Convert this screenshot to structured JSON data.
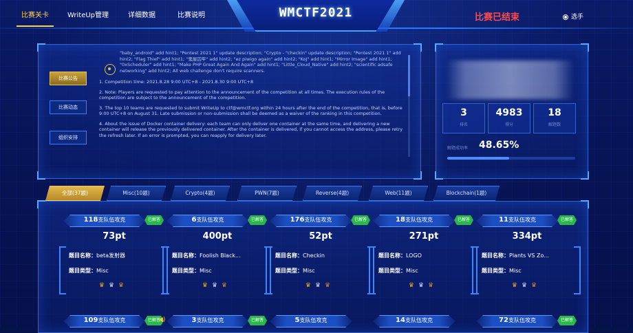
{
  "nav": {
    "items": [
      "比赛关卡",
      "WriteUp管理",
      "详细数据",
      "比赛说明"
    ],
    "active": "比赛关卡"
  },
  "header": {
    "title": "WMCTF2021",
    "status": "比赛已结束",
    "player_label": "选手"
  },
  "side": {
    "buttons": [
      "比赛公告",
      "比赛动态",
      "组织安排"
    ]
  },
  "notice": {
    "hints": "\"baby_android\" add hint1; \"Pentest 2021 1\" update description; \"Crypto - \"checkin\" update description; \"Pentest 2021 1\" add hint2; \"Flag Thief\" add hint1; \"鬼屋囚牢\" add hint2; \"ez piwigo again\" add hint2; \"KoJ\" add hint1; \"Mirror Image\" add hint1; \"0xScheduler\" add hint1; \"Make PHP Great Again And Again\" add hint1; \"Little_Cloud_Native\" add hint2; \"scientific adsafe networking\" add hint2; All web challenge don't require scanners.",
    "paragraphs": [
      "1. Competition time: 2021.8.28 9:00 UTC+8 - 2021.8.30 9:00 UTC+8",
      "2. Note: Players are requested to pay attention to the announcement of the competition at all times. The execution rules of the competition are subject to the announcement of the competition.",
      "3. The top 10 teams are requested to submit WriteUp to ctf@wmctf.org within 24 hours after the end of the competition, that is, before 9:00 UTC+8 on August 31. Late submission or non-submission shall be deemed as a waiver of the ranking in this competition.",
      "4. About the issue of Docker container delivery: each team can only deliver one container at the same time, and delivering a new container will release the previously delivered container. After the container is delivered, if you cannot access the address, please retry the refresh later. If an error is prompted, you can reapply for delivery later."
    ]
  },
  "stats": {
    "rank": "3",
    "rank_label": "排名",
    "score": "4983",
    "score_label": "得分",
    "solved": "18",
    "solved_label": "解题数",
    "rate_label": "解题成功率",
    "rate": "48.65%",
    "rate_fraction": 0.4865,
    "accent": "#4f8cff"
  },
  "tabs": [
    "全部(37题)",
    "Misc(10题)",
    "Crypto(4题)",
    "PWN(7题)",
    "Reverse(4题)",
    "Web(11题)",
    "Blockchain(1题)"
  ],
  "cards_row1": [
    {
      "solvers": "118",
      "solvers_suffix": "支队伍攻克",
      "badge": "已解答",
      "points": "73pt",
      "name_label": "题目名称：",
      "name": "beta发射器",
      "type_label": "题目类型：",
      "type": "Misc"
    },
    {
      "solvers": "6",
      "solvers_suffix": "支队伍攻克",
      "badge": "已解答",
      "points": "400pt",
      "name_label": "题目名称：",
      "name": "Foolish Black...",
      "type_label": "题目类型：",
      "type": "Misc"
    },
    {
      "solvers": "176",
      "solvers_suffix": "支队伍攻克",
      "badge": "已解答",
      "points": "52pt",
      "name_label": "题目名称：",
      "name": "Checkin",
      "type_label": "题目类型：",
      "type": "Misc"
    },
    {
      "solvers": "18",
      "solvers_suffix": "支队伍攻克",
      "badge": "已解答",
      "points": "271pt",
      "name_label": "题目名称：",
      "name": "LOGO",
      "type_label": "题目类型：",
      "type": "Misc"
    },
    {
      "solvers": "11",
      "solvers_suffix": "支队伍攻克",
      "badge": "已解答",
      "points": "334pt",
      "name_label": "题目名称：",
      "name": "Plants VS Zo...",
      "type_label": "题目类型：",
      "type": "Misc"
    }
  ],
  "cards_row2": [
    {
      "solvers": "109",
      "solvers_suffix": "支队伍攻克",
      "badge": "已解答"
    },
    {
      "solvers": "3",
      "solvers_suffix": "支队伍攻克",
      "badge": "已解答"
    },
    {
      "solvers": "5",
      "solvers_suffix": "支队伍攻克",
      "badge": ""
    },
    {
      "solvers": "14",
      "solvers_suffix": "支队伍攻克",
      "badge": ""
    },
    {
      "solvers": "72",
      "solvers_suffix": "支队伍攻克",
      "badge": "已解答"
    }
  ],
  "crown_icons": [
    "crown-gold-icon",
    "crown-silver-icon",
    "crown-bronze-icon"
  ]
}
